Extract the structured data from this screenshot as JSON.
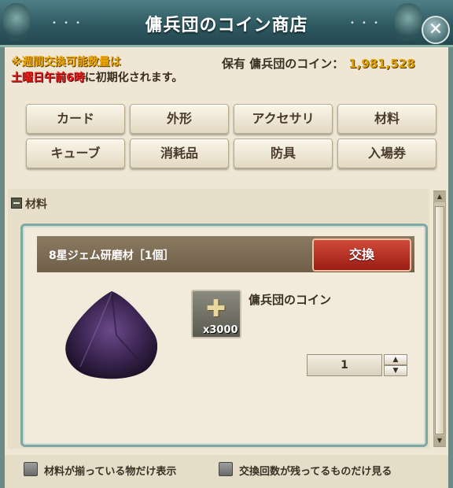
{
  "window": {
    "title": "傭兵団のコイン商店",
    "close_glyph": "✕"
  },
  "notice": {
    "line1": "※週間交換可能数量は",
    "line2_red": "土曜日午前6時",
    "line2_rest": "に初期化されます。"
  },
  "coins": {
    "label": "保有 傭兵団のコイン：",
    "amount": "1,981,528"
  },
  "categories": [
    {
      "label": "カード"
    },
    {
      "label": "外形"
    },
    {
      "label": "アクセサリ"
    },
    {
      "label": "材料"
    },
    {
      "label": "キューブ"
    },
    {
      "label": "消耗品"
    },
    {
      "label": "防具"
    },
    {
      "label": "入場券"
    }
  ],
  "section": {
    "title": "材料"
  },
  "item": {
    "name": "8星ジェム研磨材［1個］",
    "exchange_label": "交換",
    "cost_currency": "傭兵団のコイン",
    "cost_quantity": "x3000",
    "quantity_value": "1"
  },
  "filters": {
    "only_materials": "材料が揃っている物だけ表示",
    "only_remaining": "交換回数が残ってるものだけ見る"
  },
  "colors": {
    "accent_teal": "#2f5a62",
    "coin_gold": "#e0a000",
    "notice_red": "#e41d1d",
    "exchange_red": "#b02a1e"
  }
}
